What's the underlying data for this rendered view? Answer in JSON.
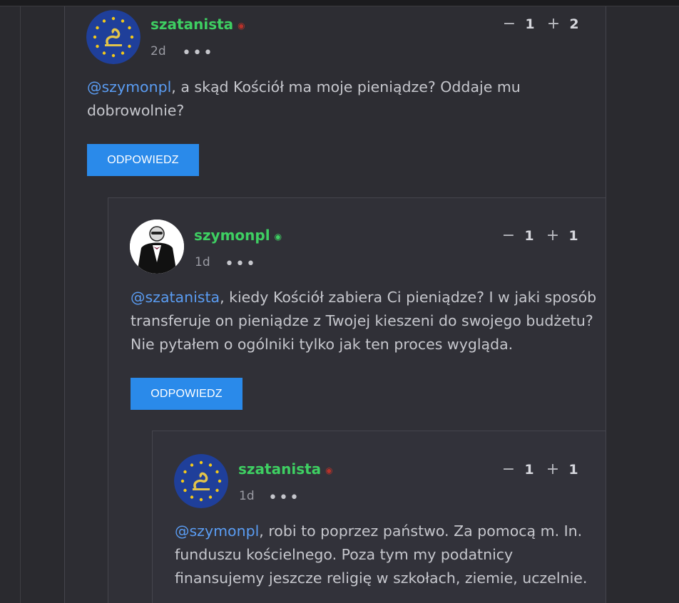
{
  "comments": [
    {
      "username": "szatanista",
      "time": "2d",
      "more": "•••",
      "downvote": "−",
      "downvote_count": "1",
      "upvote": "+",
      "upvote_count": "2",
      "mention": "@szymonpl",
      "text_line1": ", a skąd Kościół ma moje pieniądze? Oddaje mu",
      "text_line2": "dobrowolnie?",
      "reply_label": "ODPOWIEDZ",
      "feed_icon": "rss-icon",
      "avatar_icon": "gadsden-eu-flag-avatar"
    },
    {
      "username": "szymonpl",
      "time": "1d",
      "more": "•••",
      "downvote": "−",
      "downvote_count": "1",
      "upvote": "+",
      "upvote_count": "1",
      "mention": "@szatanista",
      "text_line1": ", kiedy Kościół zabiera Ci pieniądze? I w jaki sposób",
      "text_line2": "transferuje on pieniądze z Twojej kieszeni do swojego budżetu?",
      "text_line3": "Nie pytałem o ogólniki tylko jak ten proces wygląda.",
      "reply_label": "ODPOWIEDZ",
      "feed_icon": "rss-icon",
      "avatar_icon": "tuxedo-man-avatar"
    },
    {
      "username": "szatanista",
      "time": "1d",
      "more": "•••",
      "downvote": "−",
      "downvote_count": "1",
      "upvote": "+",
      "upvote_count": "1",
      "mention": "@szymonpl",
      "text_line1": ", robi to poprzez państwo. Za pomocą m. In.",
      "text_line2": "funduszu kościelnego. Poza tym my podatnicy",
      "text_line3": "finansujemy jeszcze religię w szkołach, ziemie, uczelnie.",
      "feed_icon": "rss-icon",
      "avatar_icon": "gadsden-eu-flag-avatar"
    }
  ],
  "colors": {
    "background": "#2a2a2f",
    "username": "#3ecf62",
    "mention": "#5a9cf2",
    "button": "#2a8aea"
  }
}
